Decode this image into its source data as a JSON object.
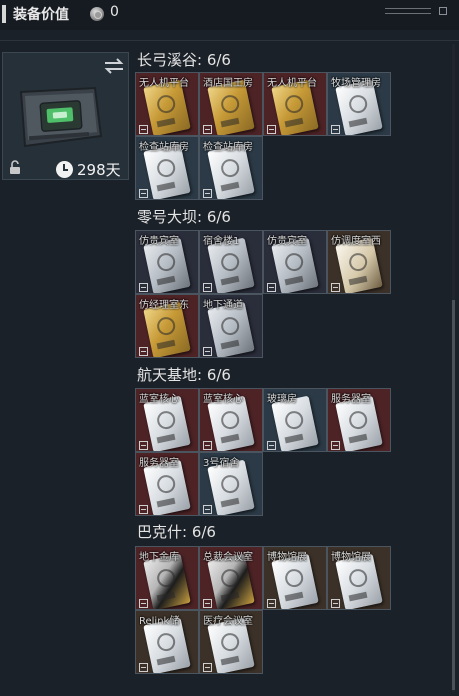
{
  "header": {
    "title": "装备价值",
    "value": "0"
  },
  "item_card": {
    "duration": "298天"
  },
  "sections": [
    {
      "title": "长弓溪谷: 6/6",
      "slots": [
        {
          "label": "无人机平台",
          "bg": "red",
          "card": "gold"
        },
        {
          "label": "酒店国王房",
          "bg": "red",
          "card": "gold"
        },
        {
          "label": "无人机平台",
          "bg": "red",
          "card": "gold"
        },
        {
          "label": "牧场管理房",
          "bg": "slate",
          "card": "white"
        },
        {
          "label": "检查站库房",
          "bg": "slate",
          "card": "white"
        },
        {
          "label": "检查站库房",
          "bg": "slate",
          "card": "white"
        }
      ]
    },
    {
      "title": "零号大坝: 6/6",
      "slots": [
        {
          "label": "仿贵宾室",
          "bg": "dark",
          "card": "silver"
        },
        {
          "label": "宿舍楼1",
          "bg": "dark",
          "card": "silver"
        },
        {
          "label": "仿贵宾室",
          "bg": "dark",
          "card": "silver"
        },
        {
          "label": "仿调度室西",
          "bg": "brown",
          "card": "brownwhite"
        },
        {
          "label": "仿经理室东",
          "bg": "red",
          "card": "gold"
        },
        {
          "label": "地下通道",
          "bg": "dark",
          "card": "silver"
        }
      ]
    },
    {
      "title": "航天基地: 6/6",
      "slots": [
        {
          "label": "蓝室核心",
          "bg": "red",
          "card": "white"
        },
        {
          "label": "蓝室核心",
          "bg": "red",
          "card": "white"
        },
        {
          "label": "玻璃房",
          "bg": "slate",
          "card": "white"
        },
        {
          "label": "服务器室",
          "bg": "red",
          "card": "white"
        },
        {
          "label": "服务器室",
          "bg": "red",
          "card": "white"
        },
        {
          "label": "3号宿舍",
          "bg": "slate",
          "card": "white"
        }
      ]
    },
    {
      "title": "巴克什: 6/6",
      "slots": [
        {
          "label": "地下金库",
          "bg": "red",
          "card": "blackgold"
        },
        {
          "label": "总裁会议室",
          "bg": "red",
          "card": "blackgold"
        },
        {
          "label": "博物馆展",
          "bg": "brown",
          "card": "white"
        },
        {
          "label": "博物馆展",
          "bg": "brown",
          "card": "white"
        },
        {
          "label": "Relink储",
          "bg": "brown",
          "card": "white"
        },
        {
          "label": "医疗会议室",
          "bg": "brown",
          "card": "white"
        }
      ]
    }
  ]
}
